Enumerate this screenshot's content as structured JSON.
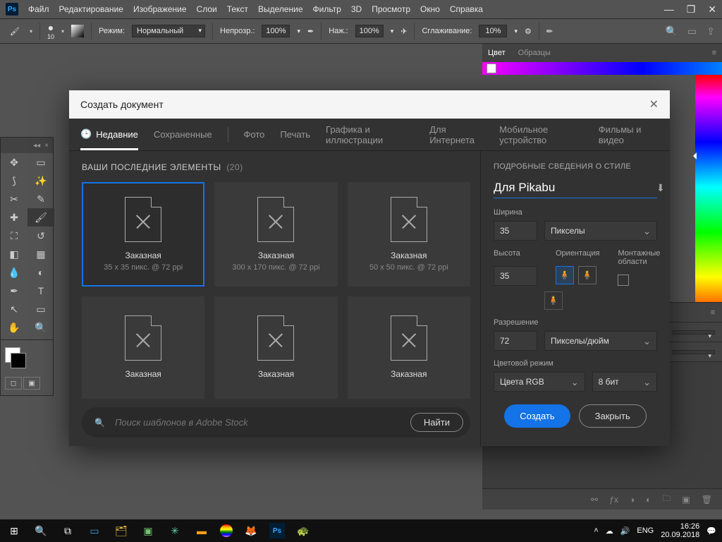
{
  "menubar": {
    "items": [
      "Файл",
      "Редактирование",
      "Изображение",
      "Слои",
      "Текст",
      "Выделение",
      "Фильтр",
      "3D",
      "Просмотр",
      "Окно",
      "Справка"
    ]
  },
  "options": {
    "brush_size": "10",
    "mode_label": "Режим:",
    "mode_value": "Нормальный",
    "opacity_label": "Непрозр.:",
    "opacity_value": "100%",
    "flow_label": "Наж.:",
    "flow_value": "100%",
    "smoothing_label": "Сглаживание:",
    "smoothing_value": "10%"
  },
  "right_panel": {
    "tab_color": "Цвет",
    "tab_swatches": "Образцы"
  },
  "dialog": {
    "title": "Создать документ",
    "tabs": {
      "recent": "Недавние",
      "saved": "Сохраненные",
      "photo": "Фото",
      "print": "Печать",
      "art": "Графика и иллюстрации",
      "web": "Для Интернета",
      "mobile": "Мобильное устройство",
      "film": "Фильмы и видео"
    },
    "presets_heading": "ВАШИ ПОСЛЕДНИЕ ЭЛЕМЕНТЫ",
    "presets_count": "(20)",
    "presets": [
      {
        "name": "Заказная",
        "meta": "35 x 35 пикс. @ 72 ppi"
      },
      {
        "name": "Заказная",
        "meta": "300 x 170 пикс. @ 72 ppi"
      },
      {
        "name": "Заказная",
        "meta": "50 x 50 пикс. @ 72 ppi"
      },
      {
        "name": "Заказная",
        "meta": ""
      },
      {
        "name": "Заказная",
        "meta": ""
      },
      {
        "name": "Заказная",
        "meta": ""
      }
    ],
    "search_placeholder": "Поиск шаблонов в Adobe Stock",
    "search_button": "Найти",
    "details": {
      "heading": "ПОДРОБНЫЕ СВЕДЕНИЯ О СТИЛЕ",
      "doc_name": "Для Pikabu",
      "width_label": "Ширина",
      "width_value": "35",
      "width_unit": "Пикселы",
      "height_label": "Высота",
      "height_value": "35",
      "orientation_label": "Ориентация",
      "artboards_label": "Монтажные области",
      "resolution_label": "Разрешение",
      "resolution_value": "72",
      "resolution_unit": "Пикселы/дюйм",
      "colormode_label": "Цветовой режим",
      "colormode_value": "Цвета RGB",
      "colordepth_value": "8 бит",
      "create_btn": "Создать",
      "close_btn": "Закрыть"
    }
  },
  "taskbar": {
    "lang": "ENG",
    "time": "16:26",
    "date": "20.09.2018"
  }
}
